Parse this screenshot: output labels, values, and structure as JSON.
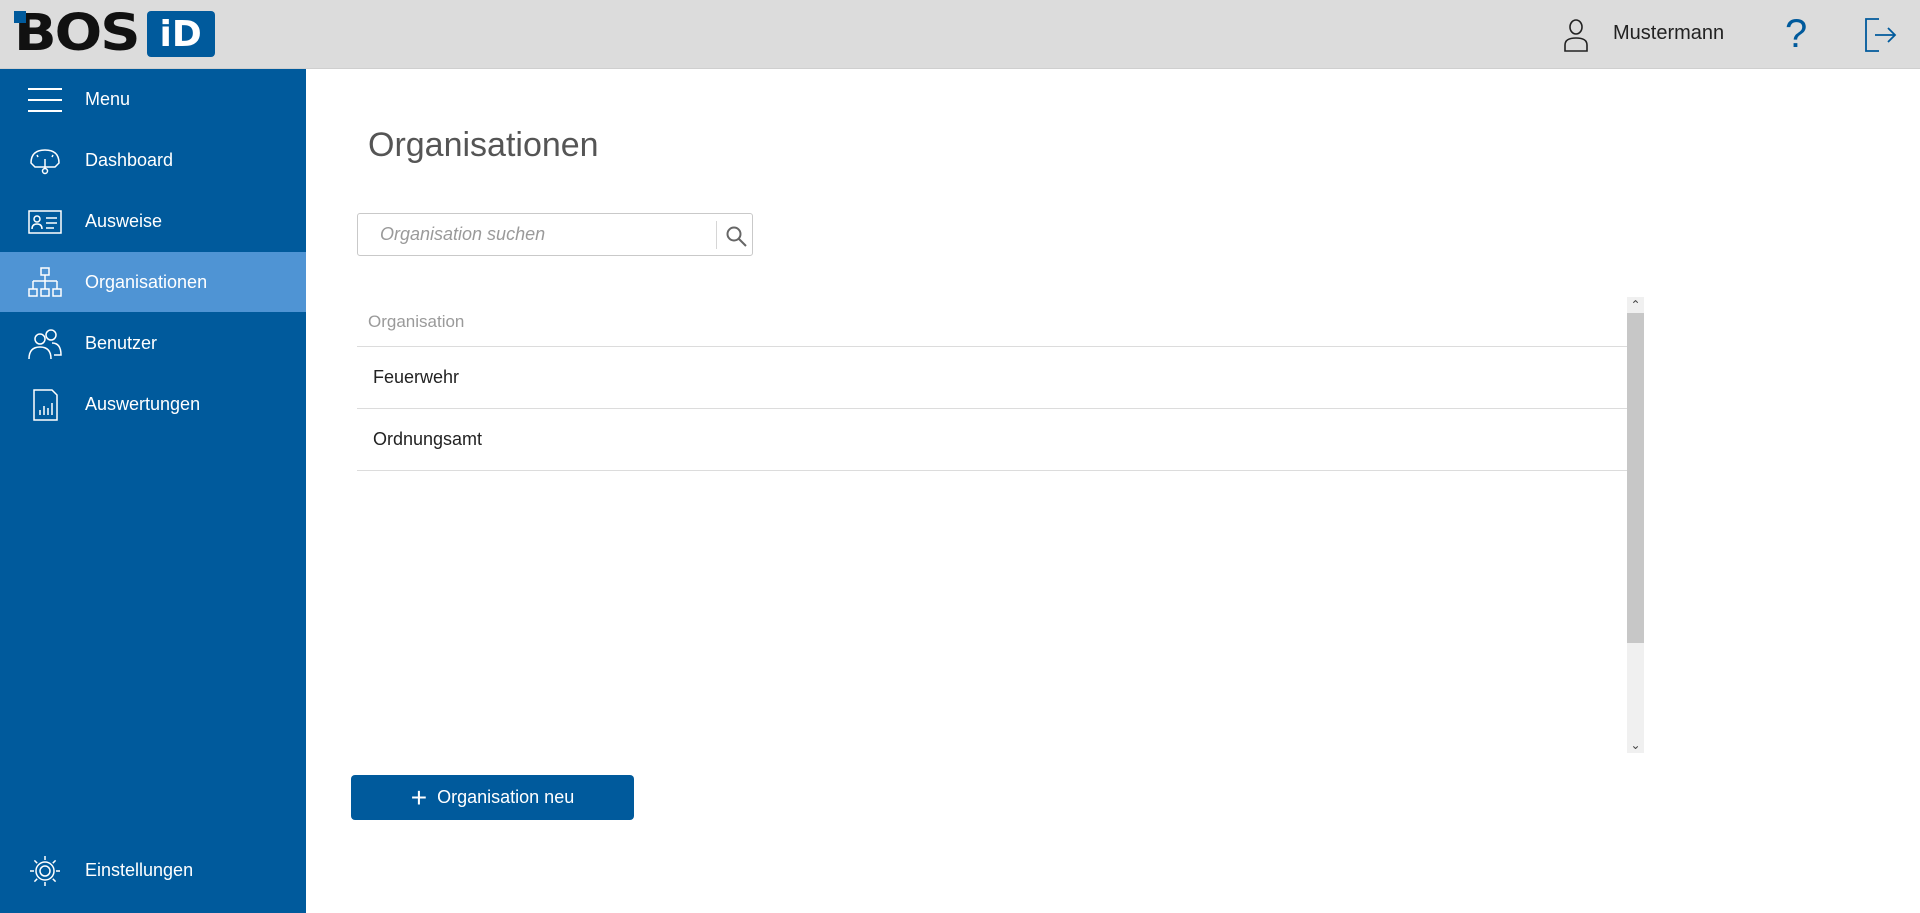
{
  "header": {
    "logo_text": "BOS",
    "logo_badge": "iD",
    "user_name": "Mustermann",
    "help_symbol": "?",
    "icons": {
      "user": "user-icon",
      "help": "help-icon",
      "logout": "logout-icon"
    }
  },
  "sidebar": {
    "items": [
      {
        "label": "Menu",
        "icon": "hamburger-icon"
      },
      {
        "label": "Dashboard",
        "icon": "gauge-icon"
      },
      {
        "label": "Ausweise",
        "icon": "id-card-icon"
      },
      {
        "label": "Organisationen",
        "icon": "org-chart-icon",
        "active": true
      },
      {
        "label": "Benutzer",
        "icon": "users-icon"
      },
      {
        "label": "Auswertungen",
        "icon": "report-icon"
      }
    ],
    "footer": {
      "label": "Einstellungen",
      "icon": "gear-icon"
    }
  },
  "main": {
    "title": "Organisationen",
    "search": {
      "placeholder": "Organisation suchen",
      "value": ""
    },
    "table": {
      "column": "Organisation",
      "rows": [
        "Feuerwehr",
        "Ordnungsamt"
      ]
    },
    "add_button": "Organisation neu"
  },
  "colors": {
    "primary": "#005a9c",
    "active": "#4f94d4",
    "topbar": "#dcdcdc"
  }
}
